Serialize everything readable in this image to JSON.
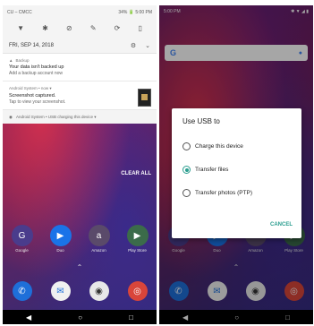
{
  "left": {
    "status": {
      "carrier": "CU – CMCC",
      "battery_time": "34% 🔋 5:00 PM"
    },
    "quick_settings": [
      {
        "icon": "wifi-icon",
        "glyph": "▼"
      },
      {
        "icon": "bluetooth-icon",
        "glyph": "✱"
      },
      {
        "icon": "dnd-icon",
        "glyph": "⊘"
      },
      {
        "icon": "flashlight-icon",
        "glyph": "✎"
      },
      {
        "icon": "rotate-icon",
        "glyph": "⟳"
      },
      {
        "icon": "battery-saver-icon",
        "glyph": "▯"
      }
    ],
    "date": "FRI, SEP 14, 2018",
    "notifications": [
      {
        "app": "Backup",
        "title": "Your data isn't backed up",
        "body": "Add a backup account now"
      },
      {
        "app": "Android System • now ▾",
        "title": "Screenshot captured.",
        "body": "Tap to view your screenshot."
      }
    ],
    "usb_line": "Android System • USB charging this device ▾",
    "clear_all": "CLEAR ALL",
    "apps": [
      "Google",
      "Duo",
      "Amazon",
      "Play Store"
    ],
    "dock": [
      "Phone",
      "Messages",
      "Camera",
      "Chrome"
    ],
    "nav": [
      "◀",
      "○",
      "□"
    ]
  },
  "right": {
    "status": {
      "time": "5:00 PM",
      "icons": "✱ ▼ ◢ ▮"
    },
    "search_logo": "G",
    "dialog": {
      "title": "Use USB to",
      "options": [
        "Charge this device",
        "Transfer files",
        "Transfer photos (PTP)"
      ],
      "selected_index": 1,
      "cancel": "CANCEL"
    },
    "apps": [
      "Google",
      "Duo",
      "Amazon",
      "Play Store"
    ],
    "dock": [
      "Phone",
      "Messages",
      "Camera",
      "Chrome"
    ],
    "nav": [
      "◀",
      "○",
      "□"
    ]
  },
  "colors": {
    "accent": "#2a9d8f",
    "google_blue": "#4285f4"
  }
}
